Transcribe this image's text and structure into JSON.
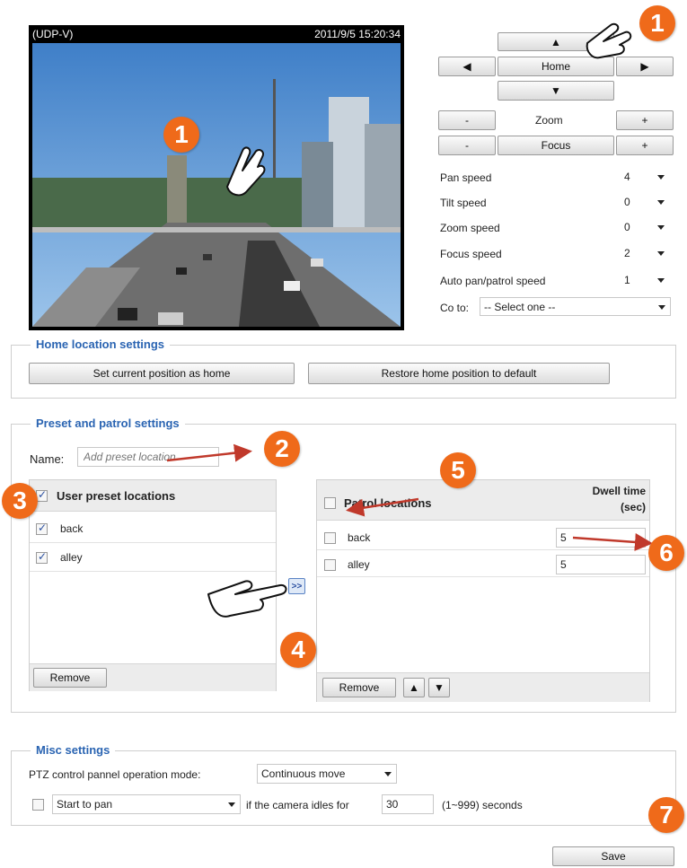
{
  "video": {
    "stream_label": "(UDP-V)",
    "timestamp": "2011/9/5 15:20:34"
  },
  "ptz": {
    "home_label": "Home",
    "zoom_label": "Zoom",
    "focus_label": "Focus",
    "minus": "-",
    "plus": "+",
    "speeds": [
      {
        "label": "Pan speed",
        "value": "4"
      },
      {
        "label": "Tilt speed",
        "value": "0"
      },
      {
        "label": "Zoom speed",
        "value": "0"
      },
      {
        "label": "Focus speed",
        "value": "2"
      },
      {
        "label": "Auto pan/patrol speed",
        "value": "1"
      }
    ],
    "goto_label": "Co to:",
    "goto_value": "-- Select one --"
  },
  "home_settings": {
    "legend": "Home location settings",
    "set_button": "Set current position as home",
    "restore_button": "Restore home position to default"
  },
  "preset": {
    "legend": "Preset and patrol settings",
    "name_label": "Name:",
    "name_placeholder": "Add preset location",
    "user_header": "User preset locations",
    "user_items": [
      "back",
      "alley"
    ],
    "remove_label": "Remove",
    "add_label": ">>",
    "patrol_header": "Patrol locations",
    "dwell_header_1": "Dwell time",
    "dwell_header_2": "(sec)",
    "patrol_items": [
      {
        "name": "back",
        "dwell": "5"
      },
      {
        "name": "alley",
        "dwell": "5"
      }
    ]
  },
  "misc": {
    "legend": "Misc settings",
    "mode_label": "PTZ control pannel operation mode:",
    "mode_value": "Continuous move",
    "idle_action": "Start to pan",
    "idle_text": "if the camera idles for",
    "idle_value": "30",
    "idle_range": "(1~999) seconds"
  },
  "save_label": "Save",
  "callouts": [
    "1",
    "1",
    "2",
    "3",
    "4",
    "5",
    "6",
    "7"
  ],
  "colors": {
    "accent": "#2a64b2",
    "callout": "#ef6a1a",
    "arrow": "#c0392b"
  }
}
